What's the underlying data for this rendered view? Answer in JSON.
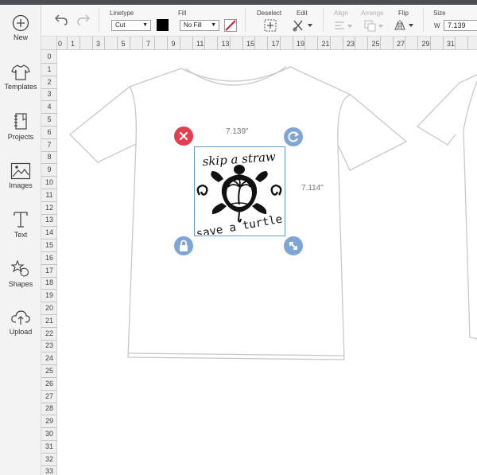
{
  "sidebar": {
    "items": [
      {
        "label": "New",
        "icon": "plus-circle-icon"
      },
      {
        "label": "Templates",
        "icon": "tshirt-icon"
      },
      {
        "label": "Projects",
        "icon": "notebook-icon"
      },
      {
        "label": "Images",
        "icon": "image-icon"
      },
      {
        "label": "Text",
        "icon": "text-t-icon"
      },
      {
        "label": "Shapes",
        "icon": "shapes-icon"
      },
      {
        "label": "Upload",
        "icon": "cloud-upload-icon"
      }
    ]
  },
  "toolbar": {
    "linetype_label": "Linetype",
    "linetype_value": "Cut",
    "linetype_color": "#000000",
    "fill_label": "Fill",
    "fill_value": "No Fill",
    "deselect_label": "Deselect",
    "edit_label": "Edit",
    "align_label": "Align",
    "arrange_label": "Arrange",
    "flip_label": "Flip",
    "size_label": "Size",
    "width_prefix": "W",
    "width_value": "7.139"
  },
  "rulers": {
    "horizontal": [
      "0",
      "1",
      "3",
      "5",
      "7",
      "9",
      "11",
      "13",
      "15",
      "17",
      "19",
      "21",
      "23",
      "25",
      "27",
      "29",
      "31"
    ],
    "vertical": [
      "0",
      "1",
      "2",
      "3",
      "4",
      "5",
      "6",
      "7",
      "8",
      "9",
      "10",
      "11",
      "12",
      "13",
      "14",
      "15",
      "16",
      "17",
      "18",
      "19",
      "20",
      "21",
      "22",
      "23",
      "24",
      "25",
      "26",
      "27",
      "28",
      "29",
      "30",
      "31",
      "32",
      "33"
    ]
  },
  "canvas": {
    "width_dimension": "7.139\"",
    "height_dimension": "7.114\"",
    "design_text_top": "skip a straw",
    "design_text_bottom": "save a turtle",
    "handle_colors": {
      "delete": "#e0404f",
      "rotate": "#7da6d6",
      "lock": "#7da6d6",
      "scale": "#7da6d6"
    },
    "selection_color": "#6a9dd0"
  }
}
